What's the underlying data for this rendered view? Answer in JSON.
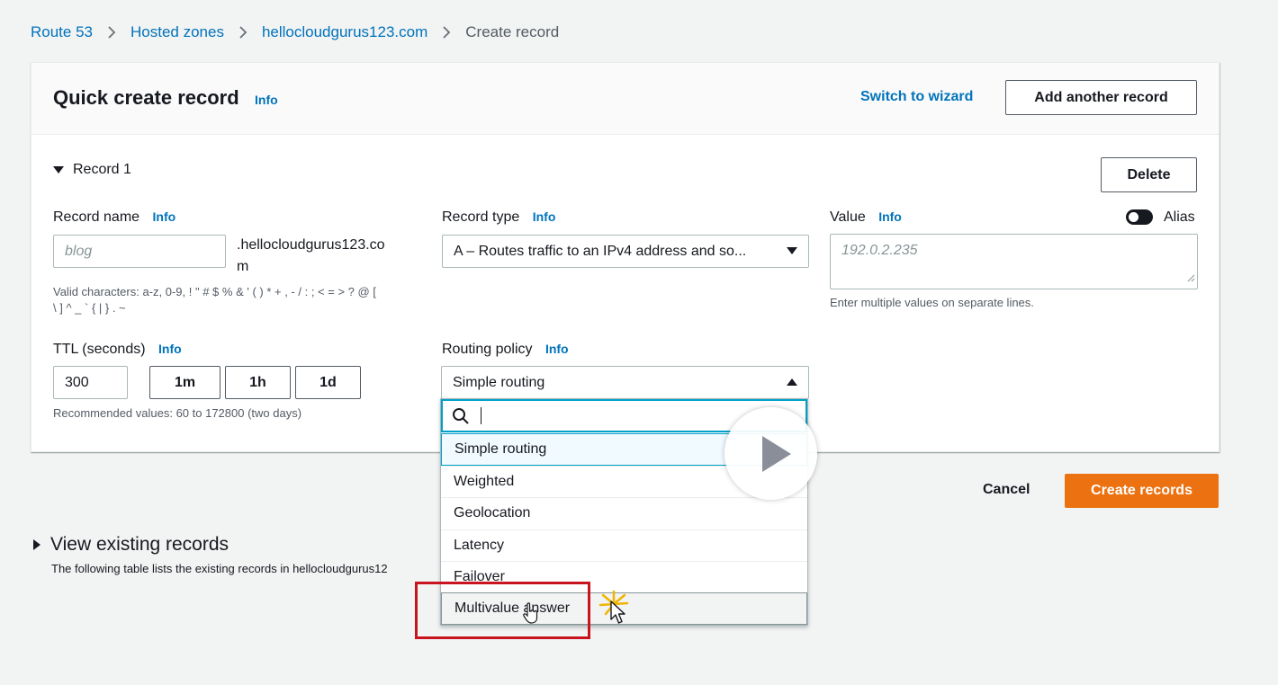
{
  "breadcrumb": {
    "items": [
      "Route 53",
      "Hosted zones",
      "hellocloudgurus123.com"
    ],
    "current": "Create record"
  },
  "header": {
    "title": "Quick create record",
    "info": "Info",
    "switch_wizard": "Switch to wizard",
    "add_another": "Add another record"
  },
  "record": {
    "section_title": "Record 1",
    "delete": "Delete",
    "name": {
      "label": "Record name",
      "info": "Info",
      "placeholder": "blog",
      "suffix_line1": ".hellocloudgurus123.co",
      "suffix_line2": "m",
      "help_line1": "Valid characters: a-z, 0-9, ! \" # $ % & ' ( ) * + , - / : ; < = > ? @ [",
      "help_line2": "\\ ] ^ _ ` { | } . ~"
    },
    "type": {
      "label": "Record type",
      "info": "Info",
      "value": "A – Routes traffic to an IPv4 address and so..."
    },
    "value": {
      "label": "Value",
      "info": "Info",
      "alias_label": "Alias",
      "placeholder": "192.0.2.235",
      "help": "Enter multiple values on separate lines."
    },
    "ttl": {
      "label": "TTL (seconds)",
      "info": "Info",
      "value": "300",
      "buttons": [
        "1m",
        "1h",
        "1d"
      ],
      "help": "Recommended values: 60 to 172800 (two days)"
    },
    "routing": {
      "label": "Routing policy",
      "info": "Info",
      "value": "Simple routing",
      "options": [
        "Simple routing",
        "Weighted",
        "Geolocation",
        "Latency",
        "Failover",
        "Multivalue answer"
      ]
    }
  },
  "actions": {
    "cancel": "Cancel",
    "create": "Create records"
  },
  "existing": {
    "title": "View existing records",
    "description": "The following table lists the existing records in hellocloudgurus12"
  },
  "colors": {
    "link": "#0073bb",
    "primary": "#ec7211",
    "highlight": "#c7141e",
    "focus": "#00a1c9"
  }
}
